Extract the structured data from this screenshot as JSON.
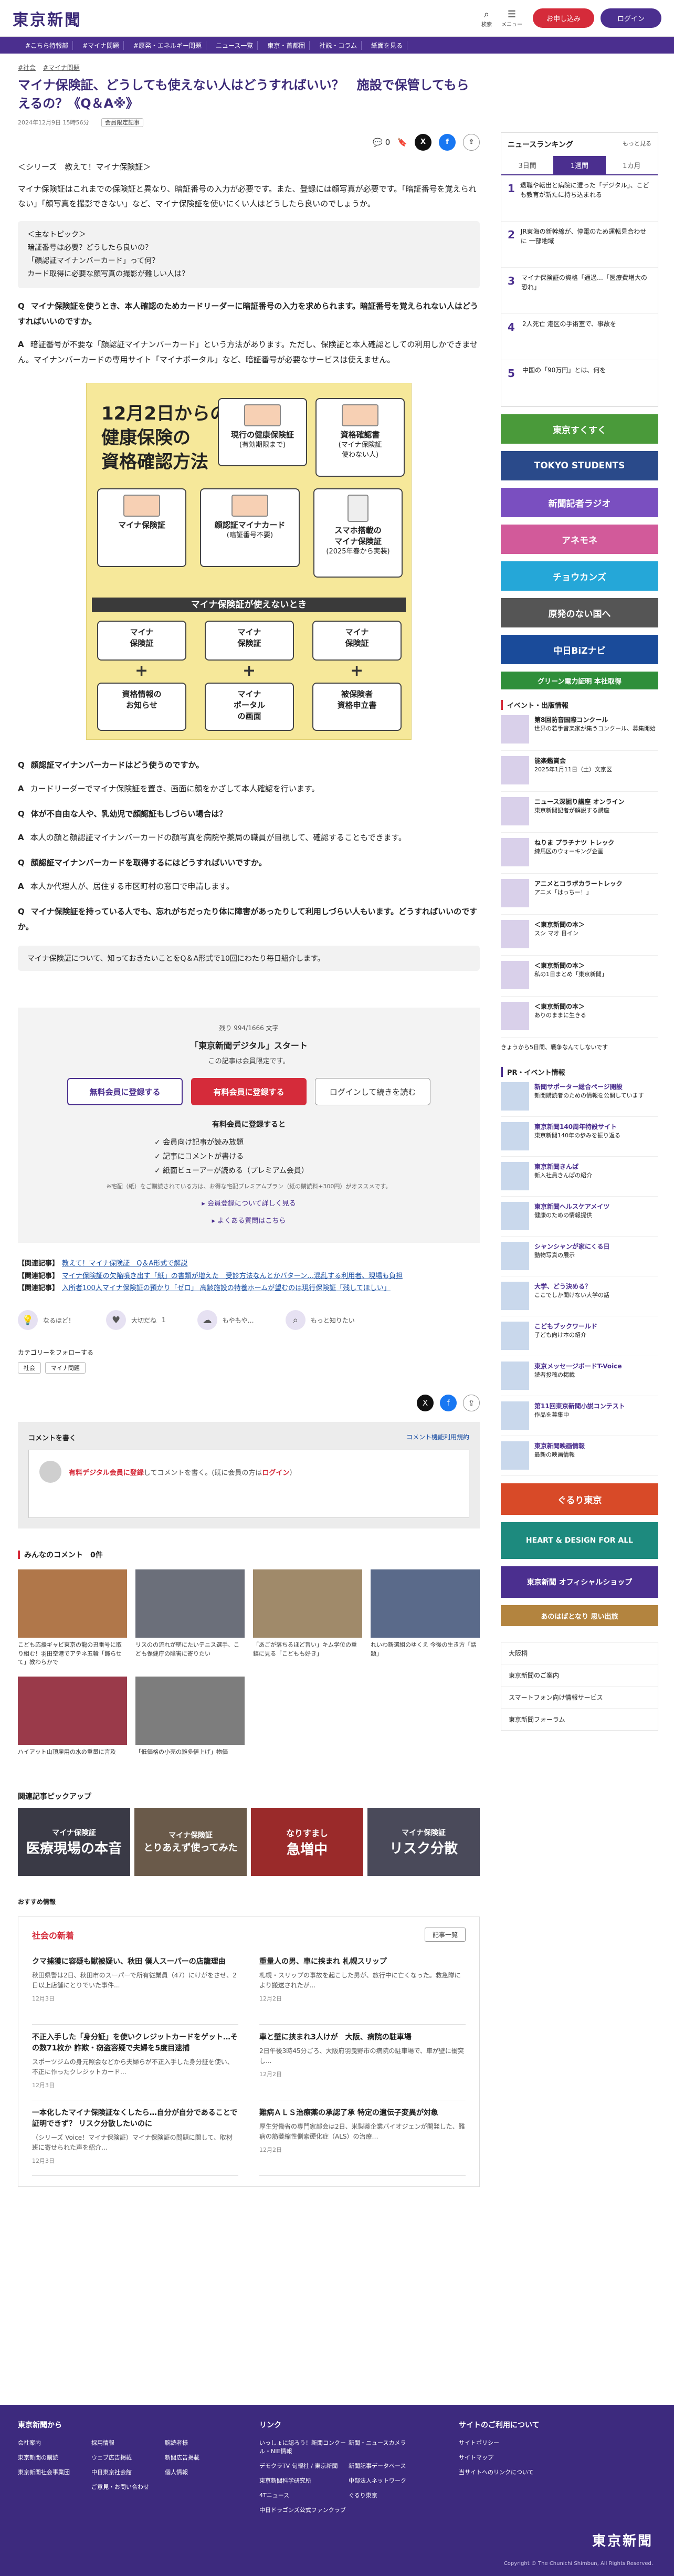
{
  "header": {
    "logo": "東京新聞",
    "search_label": "検索",
    "menu_label": "メニュー",
    "free_button": "お申し込み",
    "login_button": "ログイン"
  },
  "nav": [
    "#こちら特報部",
    "#マイナ問題",
    "#原発・エネルギー問題",
    "ニュース一覧",
    "東京・首都圏",
    "社説・コラム",
    "紙面を見る"
  ],
  "article": {
    "breadcrumbs": [
      "#社会",
      "#マイナ問題"
    ],
    "title": "マイナ保険証、どうしても使えない人はどうすればいい？　施設で保管してもらえるの？《Q＆A※》",
    "date": "2024年12月9日 15時56分",
    "badge": "会員限定記事",
    "comment_count": "0",
    "series": "＜シリーズ　教えて！マイナ保険証＞",
    "lead": "マイナ保険証はこれまでの保険証と異なり、暗証番号の入力が必要です。また、登録には顔写真が必要です。「暗証番号を覚えられない」「顔写真を撮影できない」など、マイナ保険証を使いにくい人はどうしたら良いのでしょうか。",
    "topic_title": "＜主なトピック＞",
    "topics": [
      "暗証番号は必要？どうしたら良いの？",
      "「顔認証マイナンバーカード」って何？",
      "カード取得に必要な顔写真の撮影が難しい人は？"
    ],
    "q1": "マイナ保険証を使うとき、本人確認のためカードリーダーに暗証番号の入力を求められます。暗証番号を覚えられない人はどうすればいいのですか。",
    "a1": "暗証番号が不要な「顔認証マイナンバーカード」という方法があります。ただし、保険証と本人確認としての利用しかできません。マイナンバーカードの専用サイト「マイナポータル」など、暗証番号が必要なサービスは使えません。",
    "q2": "顔認証マイナンバーカードはどう使うのですか。",
    "a2": "カードリーダーでマイナ保険証を置き、画面に顔をかざして本人確認を行います。",
    "q3": "体が不自由な人や、乳幼児で顔認証もしづらい場合は？",
    "a3": "本人の顔と顔認証マイナンバーカードの顔写真を病院や薬局の職員が目視して、確認することもできます。",
    "q4": "顔認証マイナンバーカードを取得するにはどうすればいいですか。",
    "a4": "本人か代理人が、居住する市区町村の窓口で申請します。",
    "q5": "マイナ保険証を持っている人でも、忘れがちだったり体に障害があったりして利用しづらい人もいます。どうすればいいのですか。",
    "a5_start": "マイナ保険証について、知っておきたいことをQ＆A形式で10回にわたり毎日紹介します。",
    "q_label": "Q",
    "a_label": "A"
  },
  "infographic": {
    "title_lines": [
      "12月2日からの",
      "健康保険の",
      "資格確認方法"
    ],
    "card_current": [
      "現行の健康保険証",
      "(有効期限まで)"
    ],
    "card_shikaku": [
      "資格確認書",
      "(マイナ保険証",
      "使わない人)"
    ],
    "card_maina": "マイナ保険証",
    "card_face": [
      "顔認証マイナカード",
      "(暗証番号不要)"
    ],
    "card_phone": [
      "スマホ搭載の",
      "マイナ保険証",
      "(2025年春から実装)"
    ],
    "band": "マイナ保険証が使えないとき",
    "bottom": [
      {
        "top": [
          "マイナ",
          "保険証"
        ],
        "bottom": [
          "資格情報の",
          "お知らせ"
        ]
      },
      {
        "top": [
          "マイナ",
          "保険証"
        ],
        "bottom": [
          "マイナ",
          "ポータル",
          "の画面"
        ]
      },
      {
        "top": [
          "マイナ",
          "保険証"
        ],
        "bottom": [
          "被保険者",
          "資格申立書"
        ]
      }
    ]
  },
  "series_note": "マイナ保険証について、知っておきたいことをQ＆A形式で10回にわたり毎日紹介します。",
  "paywall": {
    "count": "残り 994/1666 文字",
    "head": "「東京新聞デジタル」スタート",
    "sub": "この記事は会員限定です。",
    "btn_free": "無料会員に登録する",
    "btn_paid": "有料会員に登録する",
    "btn_login": "ログインして続きを読む",
    "benefit_head": "有料会員に登録すると",
    "benefits": [
      "✓ 会員向け記事が読み放題",
      "✓ 記事にコメントが書ける",
      "✓ 紙面ビューアーが読める（プレミアム会員）"
    ],
    "note": "※宅配（紙）をご購読されている方は、お得な宅配プレミアムプラン（紙の購読料+300円）がオススメです。",
    "link1": "▸ 会員登録について詳しく見る",
    "link2": "▸ よくある質問はこちら"
  },
  "related": [
    {
      "head": "【関連記事】",
      "text": "教えて！マイナ保険証　Q＆A形式で解説"
    },
    {
      "head": "【関連記事】",
      "text": "マイナ保険証の欠陥噴き出す「紙」の書類が増えた　受診方法なんとかバターン…混乱する利用者、現場も負担"
    },
    {
      "head": "【関連記事】",
      "text": "入所者100人マイナ保険証の預かり「ゼロ」 高齢施設の特養ホームが望むのは現行保険証「残してほしい」"
    }
  ],
  "reactions": [
    "なるほど！",
    "大切だね",
    "もやもや…",
    "もっと知りたい"
  ],
  "reaction_count": "1",
  "category": {
    "head": "カテゴリーをフォローする",
    "tags": [
      "社会",
      "マイナ問題"
    ]
  },
  "comments": {
    "head": "コメントを書く",
    "rules_link": "コメント機能利用規約",
    "message_pre": "有料デジタル会員に登録",
    "message_post": "してコメントを書く。(既に会員の方は",
    "login": "ログイン",
    "message_end": "）"
  },
  "popular": {
    "head": "みんなのコメント　0件",
    "items": [
      "こども応援ギャビ東京の龍の丑番号に取り組む！羽田空港でアテネ五輪「飾らせて」教わらかで",
      "リスのの流れが墜にたいテニス選手、こども保健庁の障害に寄りたい",
      "「あごが落ちるほど旨い」キム学位の重鎮に見る「こどもも好き」",
      "れいわ新選組のゆくえ 今後の生き方「話題」",
      "ハイアット山頂雇用の水の重量に言及",
      "「低価格の小売の雑多値上げ」物価",
      "",
      ""
    ]
  },
  "pickup": {
    "head": "関連記事ピックアップ",
    "items": [
      {
        "label": "マイナ保険証",
        "text": "医療現場の本音"
      },
      {
        "label": "マイナ保険証",
        "text": "とりあえず使ってみた"
      },
      {
        "label": "なりすまし",
        "text": "急増中"
      },
      {
        "label": "マイナ保険証",
        "text": "リスク分散"
      }
    ]
  },
  "osusume": "おすすめ情報",
  "social_news": {
    "head": "社会の新着",
    "more": "記事一覧",
    "items": [
      {
        "title": "クマ捕獲に容疑も獣被疑い、秋田 僕人スーパーの店籠理由",
        "body": "秋田県警は2日、秋田市のスーパーで所有従業員（47）にけがをさせ、2日以上店舗にとりでいた事件...",
        "date": "12月3日"
      },
      {
        "title": "重量人の男、車に挟まれ 札幌スリップ",
        "body": "札幌・スリップの事故を起こした男が、旅行中に亡くなった。救急隊により搬送されたが...",
        "date": "12月2日"
      },
      {
        "title": "不正入手した「身分証」を使いクレジットカードをゲット…その数71枚か 詐欺・窃盗容疑で夫婦を5度目逮捕",
        "body": "スポーツジムの身元照会などから夫婦らが不正入手した身分証を使い、不正に作ったクレジットカード...",
        "date": "12月3日"
      },
      {
        "title": "車と壁に挟まれ3人けが　大阪、病院の駐車場",
        "body": "2日午後3時45分ごろ、大阪府羽曳野市の病院の駐車場で、車が壁に衝突し...",
        "date": "12月2日"
      },
      {
        "title": "一本化したマイナ保険証なくしたら…自分が自分であることで証明できず？ リスク分散したいのに",
        "body": "（シリーズ Voice！マイナ保険証）マイナ保険証の問題に関して、取材班に寄せられた声を紹介…",
        "date": "12月3日"
      },
      {
        "title": "難病ＡＬＳ治療薬の承認了承 特定の遺伝子変異が対象",
        "body": "厚生労働省の専門家部会は2日、米製薬企業バイオジェンが開発した、難病の筋萎縮性側索硬化症（ALS）の治療…",
        "date": "12月2日"
      }
    ]
  },
  "sidebar": {
    "ranking_head": "ニュースランキング",
    "ranking_more": "もっと見る",
    "tabs": [
      "3日間",
      "1週間",
      "1カ月"
    ],
    "ranking": [
      "退職や転出と病院に遭った「デジタル」、こども教育が新たに持ち込まれる",
      "JR東海の新幹線が、停電のため運転見合わせに 一部地域",
      "マイナ保険証の資格「通過…「医療費増大の恐れ」",
      "2人死亡 港区の手術室で、事故を",
      "中国の「90万円」とは、何を"
    ],
    "banners": [
      {
        "text": "東京すくすく",
        "color": "#4a9a3a"
      },
      {
        "text": "TOKYO STUDENTS",
        "color": "#2a4a8a"
      },
      {
        "text": "新聞記者ラジオ",
        "color": "#7a4fc0"
      },
      {
        "text": "アネモネ",
        "color": "#d25a9a"
      },
      {
        "text": "チョウカンズ",
        "color": "#25a7d8"
      },
      {
        "text": "原発のない国へ",
        "color": "#555555"
      },
      {
        "text": "中日BiZナビ",
        "color": "#1a4b9a"
      },
      {
        "text": "グリーン電力証明 本社取得",
        "color": "#2f8f3a"
      }
    ],
    "event_head": "イベント・出版情報",
    "events": [
      {
        "title": "第8回防音国際コンクール",
        "text": "世界の若手音楽家が集うコンクール、募集開始"
      },
      {
        "title": "能楽鑑賞会",
        "text": "2025年1月11日（土）文京区"
      },
      {
        "title": "ニュース深掘り講座 オンライン",
        "text": "東京新聞記者が解説する講座"
      },
      {
        "title": "ねりま プラチナツ トレック",
        "text": "練馬区のウォーキング企画"
      },
      {
        "title": "アニメとコラボカラートレック",
        "text": "アニメ「はっちー！」"
      },
      {
        "title": "＜東京新聞の本＞",
        "text": "スシ マオ 日イン"
      },
      {
        "title": "＜東京新聞の本＞",
        "text": "私の1日まとめ「東京新聞」"
      },
      {
        "title": "＜東京新聞の本＞",
        "text": "ありのままに生きる"
      }
    ],
    "notice": "きょうから5日間、戦争なんてしないです",
    "pr_head": "PR・イベント情報",
    "prs": [
      {
        "title": "新聞サポーター総合ページ開設",
        "text": "新聞購読者のための情報を公開しています"
      },
      {
        "title": "東京新聞140周年特設サイト",
        "text": "東京新聞140年の歩みを振り返る"
      },
      {
        "title": "東京新聞きんぱ",
        "text": "新入社員きんぱの紹介"
      },
      {
        "title": "東京新聞ヘルスケアメイツ",
        "text": "健康のための情報提供"
      },
      {
        "title": "シャンシャンが家にくる日",
        "text": "動物写真の展示"
      },
      {
        "title": "大学、どう決める？",
        "text": "ここでしか聞けない大学の話"
      },
      {
        "title": "こどもブックワールド",
        "text": "子ども向け本の紹介"
      },
      {
        "title": "東京メッセージボードT-Voice",
        "text": "読者投稿の掲載"
      },
      {
        "title": "第11回東京新聞小説コンテスト",
        "text": "作品を募集中"
      },
      {
        "title": "東京新聞映画情報",
        "text": "最新の映画情報"
      }
    ],
    "banners2": [
      {
        "text": "ぐるり東京",
        "color": "#d84a28"
      },
      {
        "text": "HEART & DESIGN FOR ALL",
        "color": "#1d8a7e"
      },
      {
        "text": "東京新聞 オフィシャルショップ",
        "color": "#4b2f8f"
      },
      {
        "text": "あのはばとなり 思い出旅",
        "color": "#b3843f"
      }
    ],
    "links": [
      "大阪桐",
      "東京新聞のご案内",
      "スマートフォン向け情報サービス",
      "東京新聞フォーラム"
    ]
  },
  "footer": {
    "col1_head": "東京新聞から",
    "col1": [
      "会社案内",
      "採用情報",
      "腕読者様",
      "東京新聞の購読",
      "ウェブ広告掲載",
      "新聞広告掲載",
      "東京新聞社会事業団",
      "中日東京社会館",
      "個人情報",
      "",
      "ご意見・お問い合わせ",
      ""
    ],
    "col2_head": "リンク",
    "col2": [
      "いっしょに認ろう！新聞コンクール・NIE情報",
      "新聞・ニュースカメラ",
      "デモクラTV 旬報社 / 東京新聞",
      "新聞記事データベース",
      "東京新聞科学研究所",
      "中部法人ネットワーク",
      "4Tニュース",
      "ぐるり東京",
      "中日ドラゴンズ公式ファンクラブ",
      ""
    ],
    "col3_head": "サイトのご利用について",
    "col3": [
      "サイトポリシー",
      "サイトマップ",
      "当サイトへのリンクについて"
    ],
    "logo": "東京新聞",
    "copyright": "Copyright © The Chunichi Shimbun, All Rights Reserved."
  }
}
